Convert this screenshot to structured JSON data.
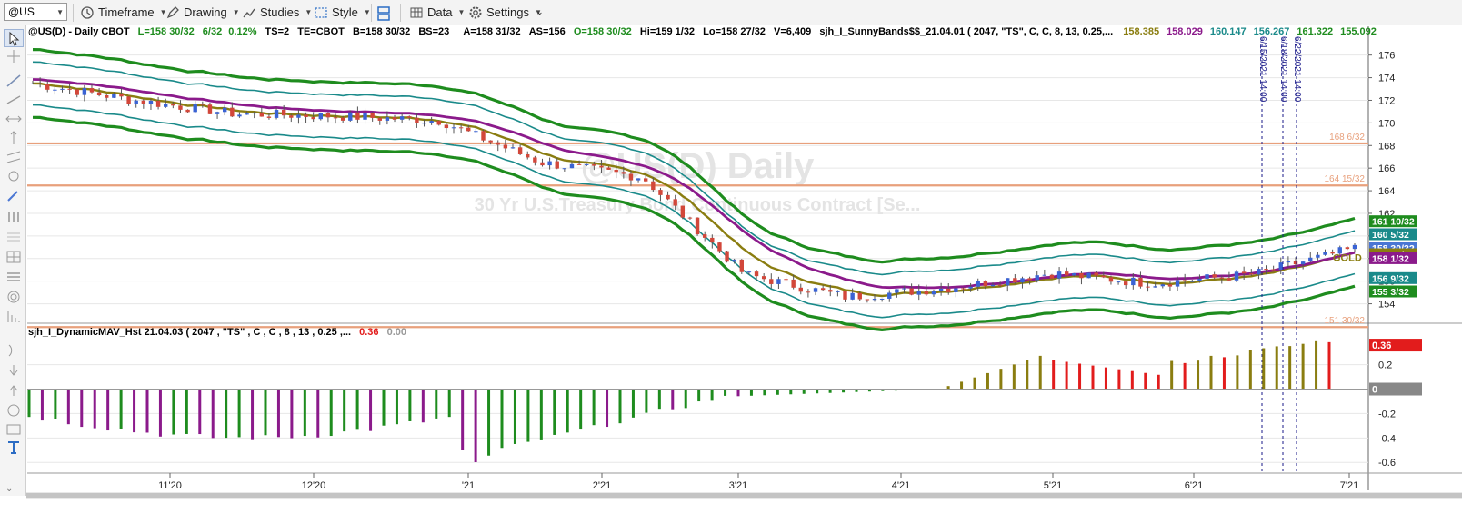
{
  "toolbar": {
    "symbol": "@US",
    "timeframe": "Timeframe",
    "drawing": "Drawing",
    "studies": "Studies",
    "style": "Style",
    "data": "Data",
    "settings": "Settings"
  },
  "header": {
    "symbol_info": "@US(D) - Daily  CBOT",
    "last": "L=158 30/32",
    "change": "6/32",
    "change_pct": "0.12%",
    "ts": "TS=2",
    "te": "TE=CBOT",
    "bid": "B=158 30/32",
    "bs": "BS=23",
    "ask": "A=158 31/32",
    "as": "AS=156",
    "open": "O=158 30/32",
    "high": "Hi=159 1/32",
    "low": "Lo=158 27/32",
    "volume": "V=6,409",
    "study": "sjh_I_SunnyBands$$_21.04.01 (  2047,  \"TS\",  C,  C,    8,  13,  0.25,...",
    "study_vals": [
      "158.385",
      "158.029",
      "160.147",
      "156.267",
      "161.322",
      "155.092"
    ],
    "study_val_colors": [
      "#8a7d10",
      "#8b1a8b",
      "#1a8a8a",
      "#1a8a8a",
      "#1e8c1e",
      "#1e8c1e"
    ]
  },
  "watermark": {
    "title": "@US(D) Daily",
    "subtitle": "30 Yr U.S.Treasury Bond Continuous Contract [Se..."
  },
  "time_labels": [
    "6/15/2021 14:00",
    "6/18/2021 14:00",
    "6/22/2021 14:00"
  ],
  "price_axis": {
    "ticks": [
      176,
      174,
      172,
      170,
      168,
      166,
      164,
      162,
      160,
      158,
      156,
      154
    ],
    "ylim": [
      152.6,
      177.5
    ]
  },
  "hlines": [
    {
      "price": 168.1875,
      "label": "168 6/32"
    },
    {
      "price": 164.46875,
      "label": "164 15/32"
    },
    {
      "price": 151.9375,
      "label": "151 30/32"
    }
  ],
  "price_tags": [
    {
      "label": "161 10/32",
      "color": "#1e8c1e",
      "price": 161.3
    },
    {
      "label": "160 5/32",
      "color": "#1a8a8a",
      "price": 160.15
    },
    {
      "label": "158 30/32",
      "color": "#4a76d4",
      "price": 158.94
    },
    {
      "label": "158 12/32",
      "color": "#8a7d10",
      "price": 158.38
    },
    {
      "label": "158 1/32",
      "color": "#8b1a8b",
      "price": 158.03
    },
    {
      "label": "156 9/32",
      "color": "#1a8a8a",
      "price": 156.27
    },
    {
      "label": "155 3/32",
      "color": "#1e8c1e",
      "price": 155.09
    }
  ],
  "gold_label": "GOLD",
  "indicator": {
    "name": "sjh_I_DynamicMAV_Hst 21.04.03 ( 2047 , \"TS\" , C , C ,  8 , 13 , 0.25 ,...",
    "value1": "0.36",
    "value2": "0.00",
    "ticks": [
      "0.2",
      "0",
      "-0.2",
      "-0.4",
      "-0.6"
    ],
    "tick_vals": [
      0.2,
      0,
      -0.2,
      -0.4,
      -0.6
    ],
    "ylim": [
      -0.68,
      0.42
    ],
    "tag": "0.36",
    "zero_tag": "0"
  },
  "x_axis": {
    "labels": [
      "11'20",
      "12'20",
      "'21",
      "2'21",
      "3'21",
      "4'21",
      "5'21",
      "6'21",
      "7'21"
    ]
  },
  "chart_data": {
    "type": "candlestick",
    "title": "@US(D) - Daily",
    "ylim": [
      152.6,
      177.5
    ],
    "x": [
      "2020-10",
      "2020-11",
      "2020-12",
      "2021-01",
      "2021-02",
      "2021-03",
      "2021-04",
      "2021-05",
      "2021-06",
      "2021-07"
    ],
    "close": [
      173.5,
      172.0,
      170.8,
      170.6,
      170.2,
      166.5,
      165.2,
      156.6,
      154.6,
      155.4,
      156.7,
      155.8,
      156.6,
      158.9
    ],
    "series": [
      {
        "name": "SunnyBands upper outer",
        "color": "#1e8c1e",
        "last": 161.322
      },
      {
        "name": "SunnyBands upper inner",
        "color": "#1a8a8a",
        "last": 160.147
      },
      {
        "name": "SunnyBands mid",
        "color": "#8a7d10",
        "last": 158.385
      },
      {
        "name": "SunnyBands mid 2",
        "color": "#8b1a8b",
        "last": 158.029
      },
      {
        "name": "SunnyBands lower inner",
        "color": "#1a8a8a",
        "last": 156.267
      },
      {
        "name": "SunnyBands lower outer",
        "color": "#1e8c1e",
        "last": 155.092
      }
    ],
    "histogram": {
      "name": "sjh_I_DynamicMAV_Hst",
      "last": 0.36,
      "min": -0.63,
      "max": 0.41
    }
  }
}
